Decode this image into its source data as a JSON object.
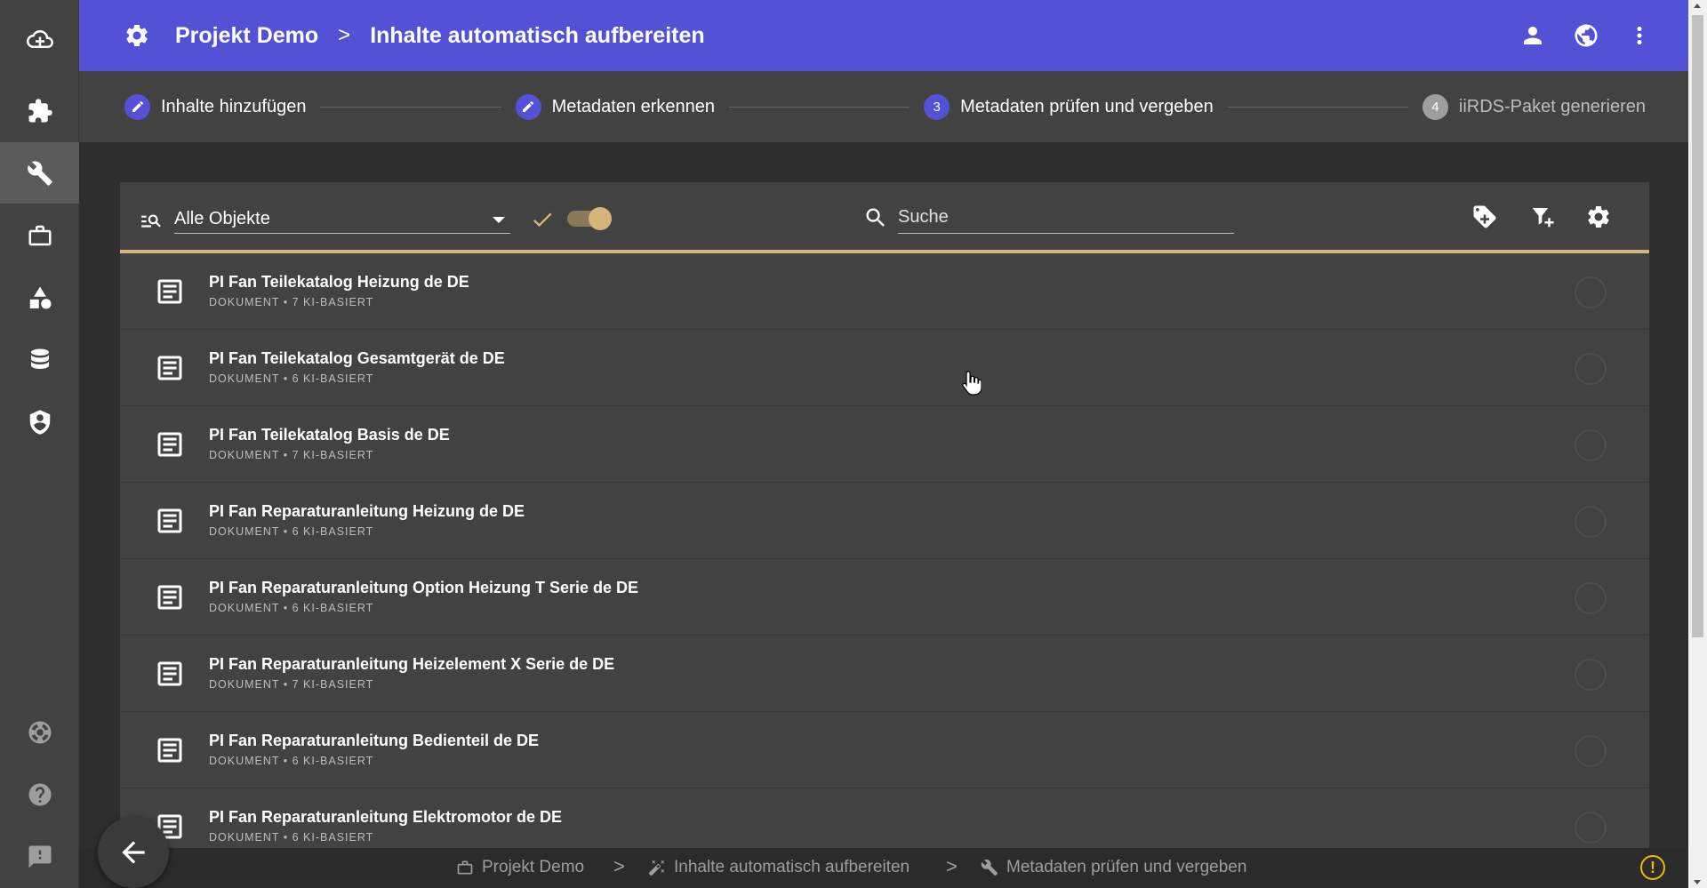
{
  "header": {
    "project": "Projekt Demo",
    "separator": ">",
    "page": "Inhalte automatisch aufbereiten"
  },
  "stepper": {
    "steps": [
      {
        "number": "",
        "label": "Inhalte hinzufügen",
        "state": "done",
        "icon": "pencil-icon"
      },
      {
        "number": "",
        "label": "Metadaten erkennen",
        "state": "done",
        "icon": "pencil-icon"
      },
      {
        "number": "3",
        "label": "Metadaten prüfen und vergeben",
        "state": "active"
      },
      {
        "number": "4",
        "label": "iiRDS-Paket generieren",
        "state": "pending"
      }
    ]
  },
  "toolbar": {
    "filter_value": "Alle Objekte",
    "search_placeholder": "Suche",
    "toggle_on": true
  },
  "items": [
    {
      "title": "PI Fan Teilekatalog Heizung de DE",
      "subtitle": "DOKUMENT • 7 KI-BASIERT"
    },
    {
      "title": "PI Fan Teilekatalog Gesamtgerät de DE",
      "subtitle": "DOKUMENT • 6 KI-BASIERT"
    },
    {
      "title": "PI Fan Teilekatalog Basis de DE",
      "subtitle": "DOKUMENT • 7 KI-BASIERT"
    },
    {
      "title": "PI Fan Reparaturanleitung Heizung de DE",
      "subtitle": "DOKUMENT • 6 KI-BASIERT"
    },
    {
      "title": "PI Fan Reparaturanleitung Option Heizung T Serie de DE",
      "subtitle": "DOKUMENT • 6 KI-BASIERT"
    },
    {
      "title": "PI Fan Reparaturanleitung Heizelement X Serie de DE",
      "subtitle": "DOKUMENT • 7 KI-BASIERT"
    },
    {
      "title": "PI Fan Reparaturanleitung Bedienteil de DE",
      "subtitle": "DOKUMENT • 6 KI-BASIERT"
    },
    {
      "title": "PI Fan Reparaturanleitung Elektromotor de DE",
      "subtitle": "DOKUMENT • 6 KI-BASIERT"
    }
  ],
  "footer": {
    "crumbs": [
      "Projekt Demo",
      "Inhalte automatisch aufbereiten",
      "Metadaten prüfen und vergeben"
    ],
    "separator": ">",
    "warning_symbol": "!"
  },
  "colors": {
    "primary": "#5352d6",
    "accent": "#d6b57a",
    "warning": "#f2b700"
  }
}
